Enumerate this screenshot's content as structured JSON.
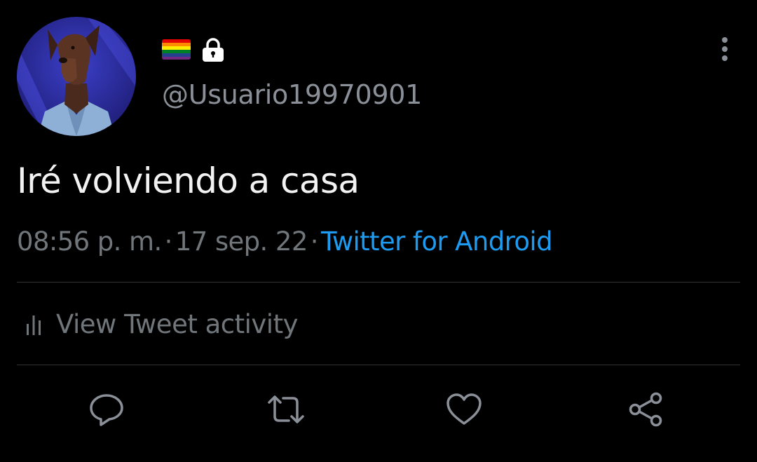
{
  "tweet": {
    "author": {
      "handle": "@Usuario19970901",
      "badges": [
        "rainbow-flag-emoji",
        "lock-icon"
      ]
    },
    "text": "Iré volviendo a casa",
    "time": "08:56 p. m.",
    "date": "17 sep. 22",
    "separator": "·",
    "source": "Twitter for Android"
  },
  "activity": {
    "label": "View Tweet activity",
    "icon": "bar-chart-icon"
  },
  "actions": [
    {
      "name": "reply",
      "icon": "reply-icon"
    },
    {
      "name": "retweet",
      "icon": "retweet-icon"
    },
    {
      "name": "like",
      "icon": "heart-icon"
    },
    {
      "name": "share",
      "icon": "share-icon"
    }
  ],
  "theme": {
    "background": "#000000",
    "text_primary": "#f2f2f2",
    "text_secondary": "#71767b",
    "link": "#1d9bf0",
    "divider": "#2f3336"
  }
}
